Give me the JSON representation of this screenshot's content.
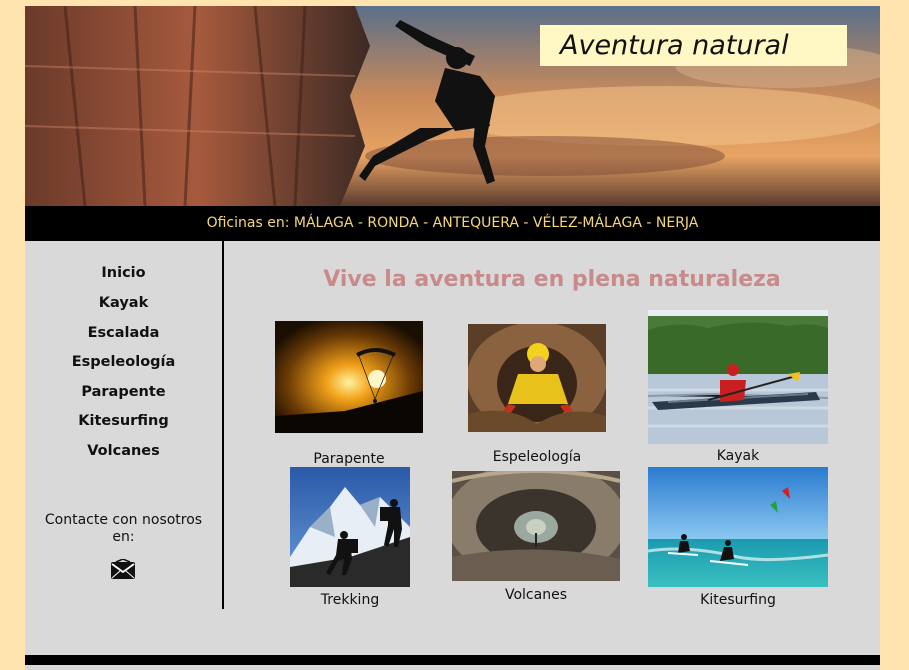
{
  "header": {
    "title": "Aventura natural",
    "offices_prefix": "Oficinas en: ",
    "cities": [
      "MÁLAGA",
      "RONDA",
      "ANTEQUERA",
      "VÉLEZ-MÁLAGA",
      "NERJA"
    ],
    "separator": " - "
  },
  "sidebar": {
    "items": [
      {
        "label": "Inicio"
      },
      {
        "label": "Kayak"
      },
      {
        "label": "Escalada"
      },
      {
        "label": "Espeleología"
      },
      {
        "label": "Parapente"
      },
      {
        "label": "Kitesurfing"
      },
      {
        "label": "Volcanes"
      }
    ],
    "contact_text": "Contacte con nosotros en:",
    "contact_icon": "envelope-icon"
  },
  "main": {
    "headline": "Vive la aventura en plena naturaleza",
    "activities": [
      {
        "label": "Parapente",
        "icon": "paragliding-photo"
      },
      {
        "label": "Espeleología",
        "icon": "caving-photo"
      },
      {
        "label": "Kayak",
        "icon": "kayak-photo"
      },
      {
        "label": "Trekking",
        "icon": "trekking-photo"
      },
      {
        "label": "Volcanes",
        "icon": "volcano-tube-photo"
      },
      {
        "label": "Kitesurfing",
        "icon": "kitesurfing-photo"
      }
    ]
  },
  "colors": {
    "page_background": "#ffe4b0",
    "content_background": "#d9d9d9",
    "headline": "#c88a8a",
    "office_text": "#f5d77a",
    "bars": "#000000"
  }
}
